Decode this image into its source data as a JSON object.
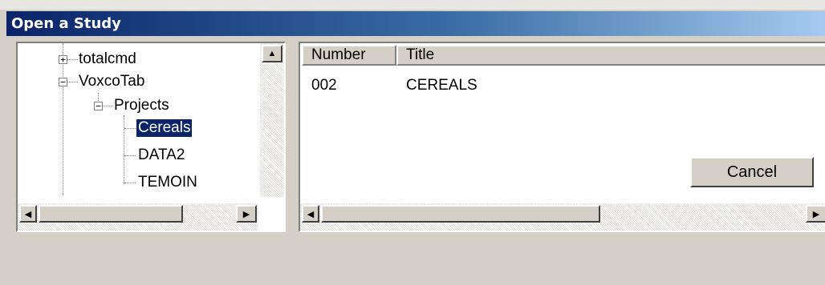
{
  "window": {
    "title": "Open a Study"
  },
  "tree": {
    "items": [
      {
        "label": "totalcmd",
        "expander": "+"
      },
      {
        "label": "VoxcoTab",
        "expander": "−"
      },
      {
        "label": "Projects",
        "expander": "−"
      },
      {
        "label": "Cereals",
        "selected": true
      },
      {
        "label": "DATA2"
      },
      {
        "label": "TEMOIN"
      }
    ]
  },
  "list": {
    "columns": [
      "Number",
      "Title"
    ],
    "rows": [
      {
        "number": "002",
        "title": "CEREALS"
      }
    ]
  },
  "buttons": {
    "cancel": "Cancel"
  },
  "icons": {
    "scroll_up": "▲",
    "scroll_left": "◀",
    "scroll_right": "▶"
  }
}
